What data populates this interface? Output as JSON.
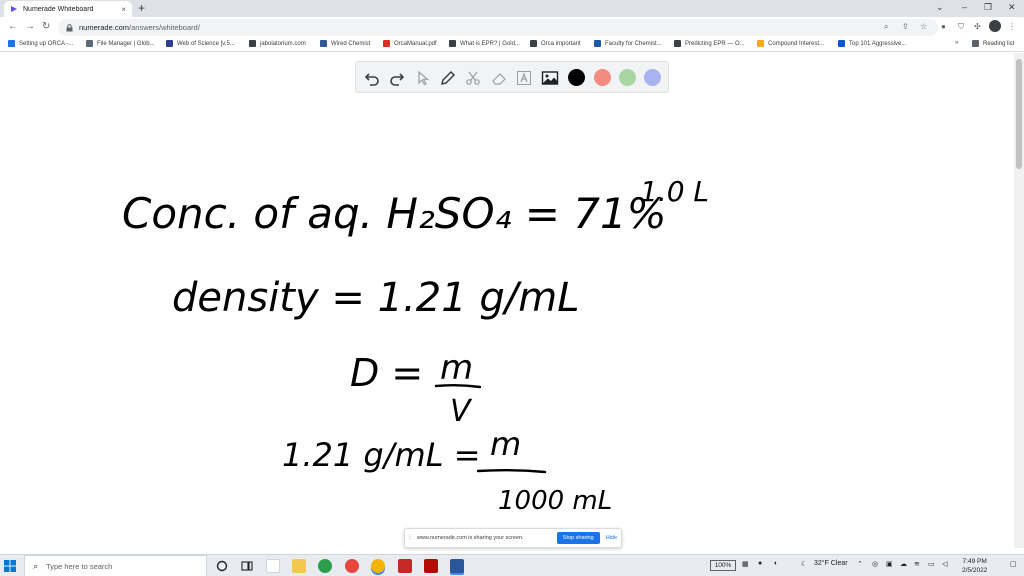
{
  "browser": {
    "tab_title": "Numerade Whiteboard",
    "tab_close": "×",
    "new_tab": "+",
    "url_host": "numerade.com",
    "url_path": "/answers/whiteboard/",
    "reading_list": "Reading list",
    "more_bookmarks": "»",
    "bookmarks": [
      {
        "label": "Setting up ORCA -...",
        "color": "#1a73e8"
      },
      {
        "label": "File Manager | Glob...",
        "color": "#5b6b7c"
      },
      {
        "label": "Web of Science [v.5...",
        "color": "#2d3e91"
      },
      {
        "label": "jabolatorium.com",
        "color": "#3c4043"
      },
      {
        "label": "Wired Chemist",
        "color": "#2f5597"
      },
      {
        "label": "OrcaManual.pdf",
        "color": "#d93025"
      },
      {
        "label": "What is EPR? | Gold...",
        "color": "#3c4043"
      },
      {
        "label": "Orca important",
        "color": "#3c4043"
      },
      {
        "label": "Faculty for Chemist...",
        "color": "#1e5aa8"
      },
      {
        "label": "Predicting EPR — O...",
        "color": "#3c4043"
      },
      {
        "label": "Compound Interest...",
        "color": "#f9ab00"
      },
      {
        "label": "Top 101 Aggressive...",
        "color": "#0b57d0"
      }
    ]
  },
  "whiteboard": {
    "swatch_colors": [
      "#000000",
      "#f28b82",
      "#a8d5a2",
      "#a8b4f0"
    ],
    "ink": {
      "line1": "Conc. of aq. H₂SO₄ = 71%",
      "side_note": "1.0 L",
      "line2": "density = 1.21 g/mL",
      "line3_lhs": "D =",
      "line3_num": "m",
      "line3_den": "V",
      "line4_lhs": "1.21 g/mL =",
      "line4_num": "m",
      "line4_den": "1000 mL"
    }
  },
  "sharebar": {
    "message": "www.numerade.com is sharing your screen.",
    "stop_label": "Stop sharing",
    "hide_label": "Hide"
  },
  "taskbar": {
    "search_placeholder": "Type here to search",
    "zoom": "100%",
    "weather": "32°F  Clear",
    "time": "7:49 PM",
    "date": "2/5/2022"
  }
}
